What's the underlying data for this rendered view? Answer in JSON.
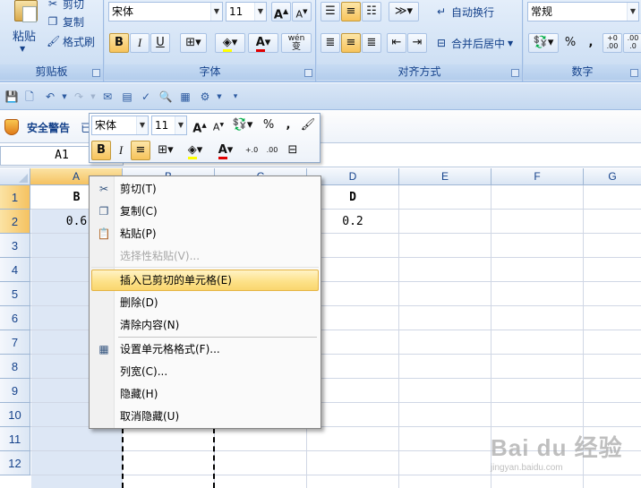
{
  "ribbon": {
    "clipboard": {
      "label": "剪贴板",
      "paste": "粘贴",
      "cut": "剪切",
      "copy": "复制",
      "format_painter": "格式刷"
    },
    "font": {
      "label": "字体",
      "font_name": "宋体",
      "font_size": "11",
      "bold": "B",
      "italic": "I",
      "underline": "U",
      "grow": "A",
      "shrink": "A",
      "font_color": "A",
      "phonetic": "wén",
      "phonetic_glyph": "变"
    },
    "alignment": {
      "label": "对齐方式",
      "wrap_text": "自动换行",
      "merge_center": "合并后居中"
    },
    "number": {
      "label": "数字",
      "format": "常规",
      "percent": "%",
      "comma": ",",
      "inc_decimal": ".00",
      "inc_decimal_top": "+0",
      "dec_decimal": ".00",
      "dec_decimal_top": ".0"
    }
  },
  "security": {
    "label": "安全警告",
    "extra": "已"
  },
  "name_box": "A1",
  "mini_toolbar": {
    "font_name": "宋体",
    "font_size": "11",
    "percent": "%",
    "comma": ",",
    "bold": "B",
    "italic": "I",
    "font_color": "A",
    "inc_decimal": "+.0",
    "dec_decimal": ".00"
  },
  "grid": {
    "columns": [
      "A",
      "B",
      "C",
      "D",
      "E",
      "F",
      "G"
    ],
    "rows": [
      "1",
      "2",
      "3",
      "4",
      "5",
      "6",
      "7",
      "8",
      "9",
      "10",
      "11",
      "12"
    ],
    "cells": {
      "A1": "B",
      "A2": "0.6",
      "D1": "D",
      "D2": "0.2"
    }
  },
  "context_menu": {
    "items": [
      {
        "label": "剪切(T)",
        "icon": "scissors-icon",
        "enabled": true
      },
      {
        "label": "复制(C)",
        "icon": "copy-icon",
        "enabled": true
      },
      {
        "label": "粘贴(P)",
        "icon": "paste-icon",
        "enabled": true
      },
      {
        "label": "选择性粘贴(V)...",
        "icon": "",
        "enabled": false
      },
      {
        "label": "插入已剪切的单元格(E)",
        "icon": "",
        "enabled": true,
        "highlighted": true
      },
      {
        "label": "删除(D)",
        "icon": "",
        "enabled": true
      },
      {
        "label": "清除内容(N)",
        "icon": "",
        "enabled": true
      },
      {
        "label": "设置单元格格式(F)...",
        "icon": "format-cells-icon",
        "enabled": true
      },
      {
        "label": "列宽(C)...",
        "icon": "",
        "enabled": true
      },
      {
        "label": "隐藏(H)",
        "icon": "",
        "enabled": true
      },
      {
        "label": "取消隐藏(U)",
        "icon": "",
        "enabled": true
      }
    ]
  },
  "watermark": {
    "brand": "Bai du 经验",
    "url": "jingyan.baidu.com"
  },
  "colors": {
    "ribbon_text": "#15428b",
    "highlight": "#f9d66e",
    "selected_header": "#f5c261",
    "selected_column": "#dde7f5"
  }
}
